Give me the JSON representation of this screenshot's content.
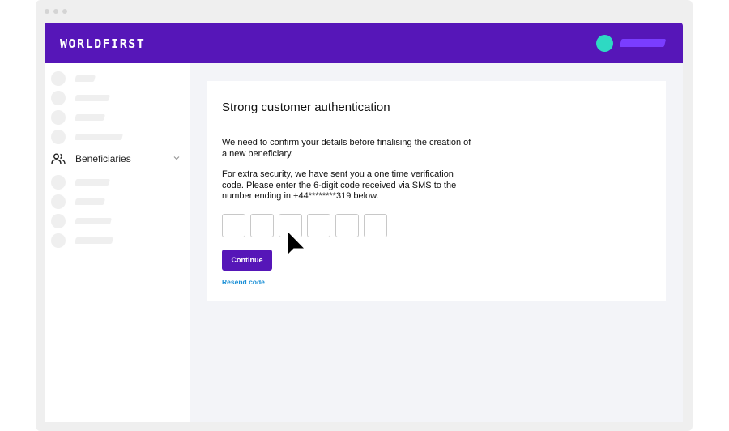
{
  "header": {
    "logo": "WORLDFIRST",
    "avatar_color": "#2ed9c3",
    "brand_color": "#5616b8"
  },
  "sidebar": {
    "active_item": {
      "label": "Beneficiaries",
      "icon": "people-icon",
      "expand_icon": "chevron-down-icon"
    }
  },
  "main": {
    "title": "Strong customer authentication",
    "paragraph1": "We need to confirm your details before finalising the creation of a new beneficiary.",
    "paragraph2": "For extra security, we have sent you a one time verification code. Please enter the 6-digit code received via SMS to the number ending in +44********319 below.",
    "otp_values": [
      "",
      "",
      "",
      "",
      "",
      ""
    ],
    "continue_label": "Continue",
    "resend_label": "Resend code",
    "link_color": "#1a8fd6"
  }
}
